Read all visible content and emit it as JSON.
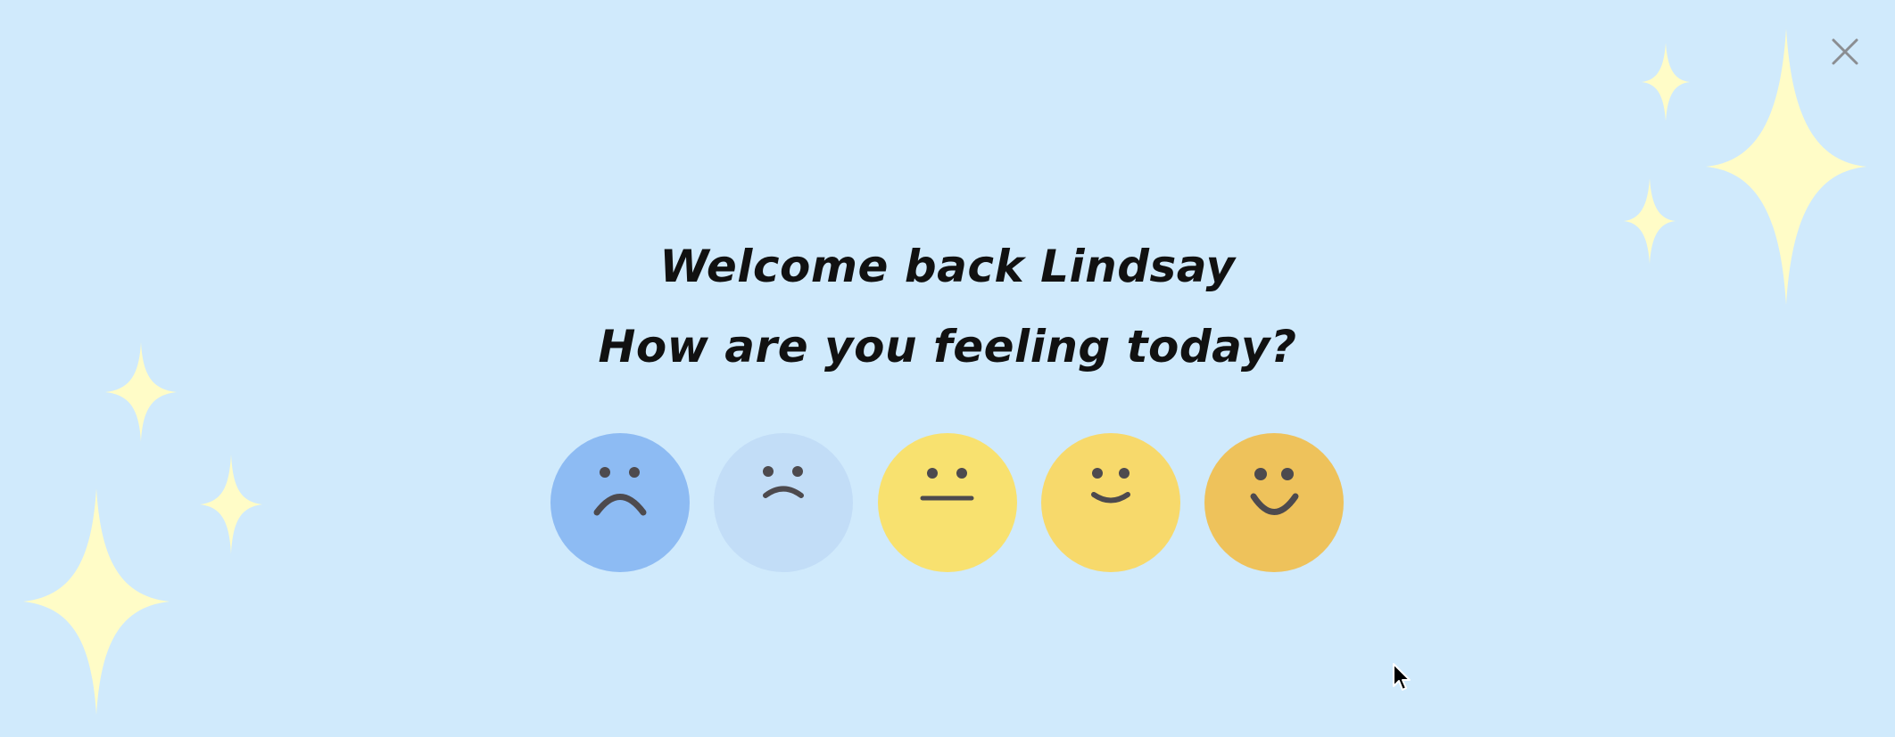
{
  "greeting": {
    "line1": "Welcome back Lindsay",
    "line2": "How are you feeling today?"
  },
  "moods": [
    {
      "name": "very-sad",
      "color": "#8dbbf3"
    },
    {
      "name": "sad",
      "color": "#c2ddf7"
    },
    {
      "name": "neutral",
      "color": "#f8e16f"
    },
    {
      "name": "content",
      "color": "#f7d96b"
    },
    {
      "name": "happy",
      "color": "#eec25b"
    }
  ],
  "colors": {
    "background": "#d0eafc",
    "sparkle": "#fffcc7",
    "face_features": "#4d4a4e",
    "close_icon": "#8b8e92"
  },
  "icons": {
    "close": "close-icon",
    "sparkle": "sparkle-icon",
    "cursor": "mouse-pointer-icon"
  }
}
